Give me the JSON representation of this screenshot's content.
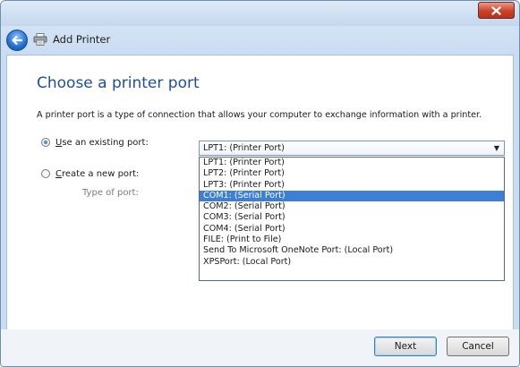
{
  "window": {
    "title": "Add Printer",
    "close_icon": "close-x-icon",
    "back_icon": "back-arrow-icon",
    "app_icon": "printer-icon"
  },
  "page": {
    "heading": "Choose a printer port",
    "description": "A printer port is a type of connection that allows your computer to exchange information with a printer."
  },
  "options": {
    "existing_port": {
      "mnemonic": "U",
      "label_rest": "se an existing port:",
      "checked": true
    },
    "new_port": {
      "mnemonic": "C",
      "label_rest": "reate a new port:",
      "checked": false
    },
    "type_of_port_label": "Type of port:"
  },
  "port_combo": {
    "value": "LPT1: (Printer Port)",
    "items": [
      {
        "label": "LPT1: (Printer Port)",
        "selected": false
      },
      {
        "label": "LPT2: (Printer Port)",
        "selected": false
      },
      {
        "label": "LPT3: (Printer Port)",
        "selected": false
      },
      {
        "label": "COM1: (Serial Port)",
        "selected": true
      },
      {
        "label": "COM2: (Serial Port)",
        "selected": false
      },
      {
        "label": "COM3: (Serial Port)",
        "selected": false
      },
      {
        "label": "COM4: (Serial Port)",
        "selected": false
      },
      {
        "label": "FILE: (Print to File)",
        "selected": false
      },
      {
        "label": "Send To Microsoft OneNote Port: (Local Port)",
        "selected": false
      },
      {
        "label": "XPSPort: (Local Port)",
        "selected": false
      }
    ]
  },
  "buttons": {
    "next_label": "Next",
    "cancel_label": "Cancel"
  },
  "colors": {
    "heading": "#1f4f9a",
    "selection": "#3d7fd4",
    "close_button": "#c9422a"
  }
}
